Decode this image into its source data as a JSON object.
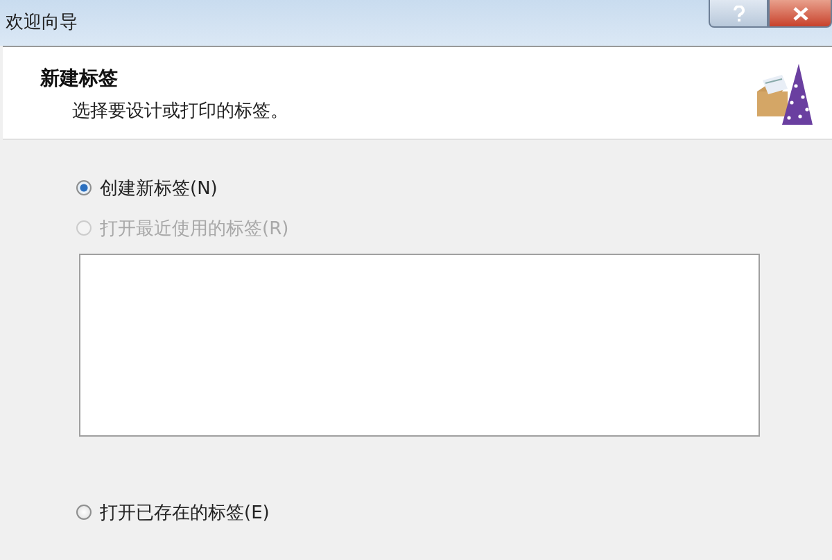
{
  "window": {
    "title": "欢迎向导"
  },
  "header": {
    "title": "新建标签",
    "subtitle": "选择要设计或打印的标签。"
  },
  "options": [
    {
      "label": "创建新标签(N)",
      "selected": true,
      "disabled": false
    },
    {
      "label": "打开最近使用的标签(R)",
      "selected": false,
      "disabled": true
    },
    {
      "label": "打开已存在的标签(E)",
      "selected": false,
      "disabled": false
    }
  ]
}
